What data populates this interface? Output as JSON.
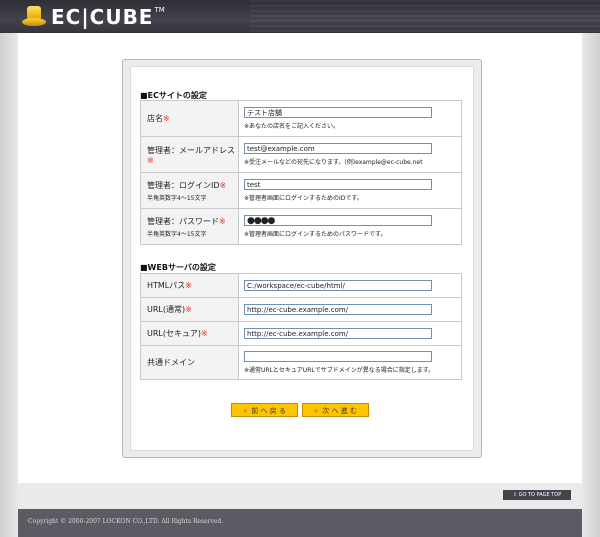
{
  "header": {
    "logo_text": "EC|CUBE",
    "logo_tm": "TM"
  },
  "shop_section": {
    "title": "■ECサイトの設定",
    "rows": [
      {
        "label": "店名",
        "sub": "",
        "value": "テスト店舗",
        "note": "※あなたの店名をご記入ください。"
      },
      {
        "label": "管理者：メールアドレス",
        "sub": "",
        "value": "test@example.com",
        "note": "※受注メールなどの宛先になります。(例)example@ec-cube.net"
      },
      {
        "label": "管理者：ログインID",
        "sub": "半角英数字4～15文字",
        "value": "test",
        "note": "※管理者画面にログインするためのIDです。"
      },
      {
        "label": "管理者：パスワード",
        "sub": "半角英数字4～15文字",
        "value": "●●●●",
        "note": "※管理者画面にログインするためのパスワードです。"
      }
    ]
  },
  "web_section": {
    "title": "■WEBサーバの設定",
    "rows": [
      {
        "label": "HTMLパス",
        "value": "C:/workspace/ec-cube/html/",
        "note": ""
      },
      {
        "label": "URL(通常)",
        "value": "http://ec-cube.example.com/",
        "note": ""
      },
      {
        "label": "URL(セキュア)",
        "value": "http://ec-cube.example.com/",
        "note": ""
      },
      {
        "label": "共通ドメイン",
        "value": "",
        "note": "※通常URLとセキュアURLでサブドメインが異なる場合に指定します。"
      }
    ]
  },
  "required_mark": "※",
  "buttons": {
    "back_chev": "«",
    "back_label": "前 へ 戻 る",
    "next_chev": "»",
    "next_label": "次 へ 進 む"
  },
  "footer": {
    "top_button": "GO TO PAGE TOP",
    "top_icon": "up-arrow-icon",
    "copyright": "Copyright © 2000-2007 LOCKON CO.,LTD. All Rights Reserved."
  },
  "colors": {
    "accent": "#ffc400",
    "required": "#e03030",
    "header": "#3a3a42"
  }
}
